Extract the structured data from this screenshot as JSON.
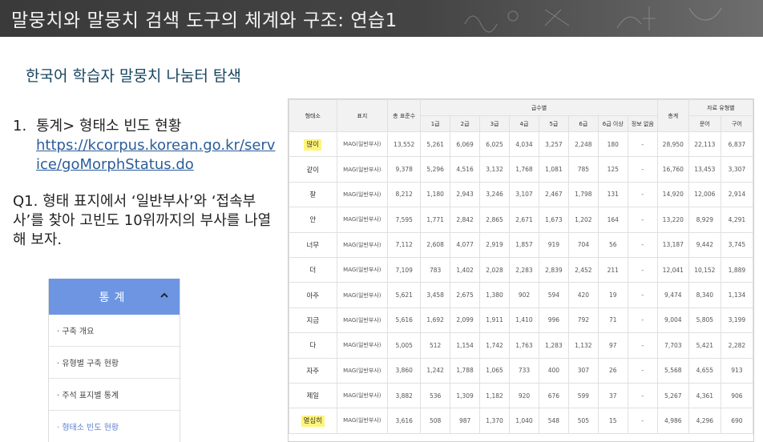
{
  "slide": {
    "title": "말뭉치와 말뭉치 검색 도구의 체계와 구조: 연습1",
    "subtitle": "한국어 학습자 말뭉치 나눔터 탐색",
    "step": {
      "number": "1.",
      "text": "통계> 형태소 빈도 현황",
      "url": "https://kcorpus.korean.go.kr/service/goMorphStatus.do"
    },
    "question": "Q1. 형태 표지에서 ‘일반부사’와 ‘접속부사’를 찾아 고빈도 10위까지의 부사를 나열해 보자."
  },
  "menu": {
    "header": "통계",
    "header_icon": "chevron-up-icon",
    "items": [
      {
        "label": "· 구축 개요",
        "active": false
      },
      {
        "label": "· 유형별 구축 현황",
        "active": false
      },
      {
        "label": "· 주석 표지별 통계",
        "active": false
      },
      {
        "label": "· 형태소 빈도 현황",
        "active": true
      }
    ]
  },
  "table": {
    "headers": {
      "morph": "형태소",
      "tag": "표지",
      "total_freq": "총 표준수",
      "grade_group": "급수별",
      "grades": [
        "1급",
        "2급",
        "3급",
        "4급",
        "5급",
        "6급",
        "6급 이상",
        "정보 없음"
      ],
      "sum": "총계",
      "material_group": "자료 유형별",
      "material_types": [
        "문어",
        "구어"
      ]
    },
    "rows": [
      {
        "morph": "많이",
        "highlight": true,
        "tag": "MAG(일반부사)",
        "total": "13,552",
        "grades": [
          "5,261",
          "6,069",
          "6,025",
          "4,034",
          "3,257",
          "2,248",
          "180",
          "-"
        ],
        "sum": "28,950",
        "types": [
          "22,113",
          "6,837"
        ]
      },
      {
        "morph": "같이",
        "highlight": false,
        "tag": "MAG(일반부사)",
        "total": "9,378",
        "grades": [
          "5,296",
          "4,516",
          "3,132",
          "1,768",
          "1,081",
          "785",
          "125",
          "-"
        ],
        "sum": "16,760",
        "types": [
          "13,453",
          "3,307"
        ]
      },
      {
        "morph": "잘",
        "highlight": false,
        "tag": "MAG(일반부사)",
        "total": "8,212",
        "grades": [
          "1,180",
          "2,943",
          "3,246",
          "3,107",
          "2,467",
          "1,798",
          "131",
          "-"
        ],
        "sum": "14,920",
        "types": [
          "12,006",
          "2,914"
        ]
      },
      {
        "morph": "안",
        "highlight": false,
        "tag": "MAG(일반부사)",
        "total": "7,595",
        "grades": [
          "1,771",
          "2,842",
          "2,865",
          "2,671",
          "1,673",
          "1,202",
          "164",
          "-"
        ],
        "sum": "13,220",
        "types": [
          "8,929",
          "4,291"
        ]
      },
      {
        "morph": "너무",
        "highlight": false,
        "tag": "MAG(일반부사)",
        "total": "7,112",
        "grades": [
          "2,608",
          "4,077",
          "2,919",
          "1,857",
          "919",
          "704",
          "56",
          "-"
        ],
        "sum": "13,187",
        "types": [
          "9,442",
          "3,745"
        ]
      },
      {
        "morph": "더",
        "highlight": false,
        "tag": "MAG(일반부사)",
        "total": "7,109",
        "grades": [
          "783",
          "1,402",
          "2,028",
          "2,283",
          "2,839",
          "2,452",
          "211",
          "-"
        ],
        "sum": "12,041",
        "types": [
          "10,152",
          "1,889"
        ]
      },
      {
        "morph": "아주",
        "highlight": false,
        "tag": "MAG(일반부사)",
        "total": "5,621",
        "grades": [
          "3,458",
          "2,675",
          "1,380",
          "902",
          "594",
          "420",
          "19",
          "-"
        ],
        "sum": "9,474",
        "types": [
          "8,340",
          "1,134"
        ]
      },
      {
        "morph": "지금",
        "highlight": false,
        "tag": "MAG(일반부사)",
        "total": "5,616",
        "grades": [
          "1,692",
          "2,099",
          "1,911",
          "1,410",
          "996",
          "792",
          "71",
          "-"
        ],
        "sum": "9,004",
        "types": [
          "5,805",
          "3,199"
        ]
      },
      {
        "morph": "다",
        "highlight": false,
        "tag": "MAG(일반부사)",
        "total": "5,005",
        "grades": [
          "512",
          "1,154",
          "1,742",
          "1,763",
          "1,283",
          "1,132",
          "97",
          "-"
        ],
        "sum": "7,703",
        "types": [
          "5,421",
          "2,282"
        ]
      },
      {
        "morph": "자주",
        "highlight": false,
        "tag": "MAG(일반부사)",
        "total": "3,860",
        "grades": [
          "1,242",
          "1,788",
          "1,065",
          "733",
          "400",
          "307",
          "26",
          "-"
        ],
        "sum": "5,568",
        "types": [
          "4,655",
          "913"
        ]
      },
      {
        "morph": "제일",
        "highlight": false,
        "tag": "MAG(일반부사)",
        "total": "3,882",
        "grades": [
          "536",
          "1,309",
          "1,182",
          "920",
          "676",
          "599",
          "37",
          "-"
        ],
        "sum": "5,267",
        "types": [
          "4,361",
          "906"
        ]
      },
      {
        "morph": "열심히",
        "highlight": true,
        "tag": "MAG(일반부사)",
        "total": "3,616",
        "grades": [
          "508",
          "987",
          "1,370",
          "1,040",
          "548",
          "505",
          "15",
          "-"
        ],
        "sum": "4,986",
        "types": [
          "4,296",
          "690"
        ]
      }
    ]
  }
}
